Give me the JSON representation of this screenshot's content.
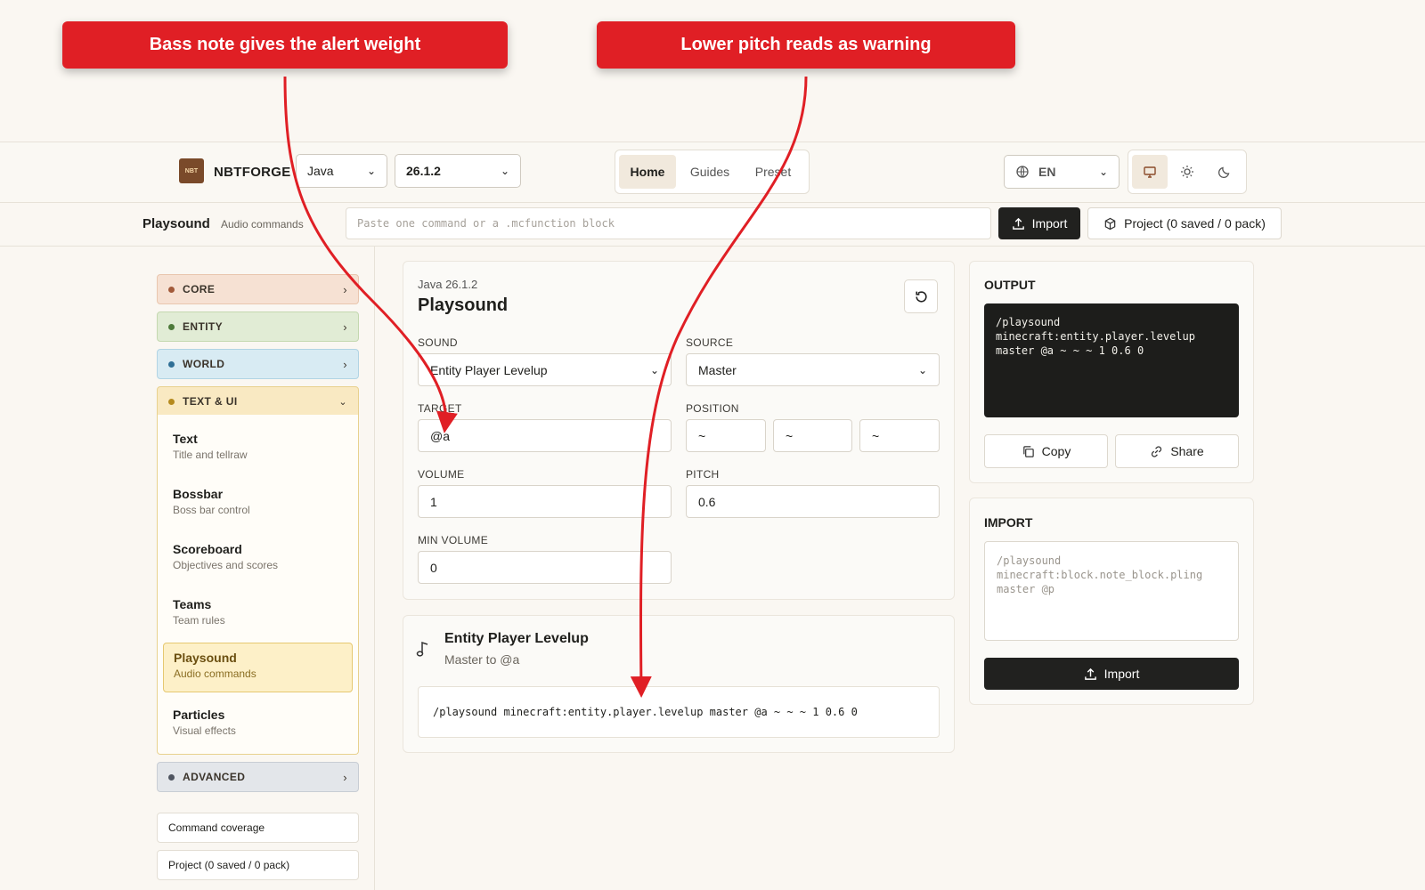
{
  "callouts": [
    {
      "text": "Bass note gives the alert weight"
    },
    {
      "text": "Lower pitch reads as warning"
    }
  ],
  "header": {
    "brand": "NBTFORGE",
    "logo_text": "NBT",
    "edition": "Java",
    "version": "26.1.2",
    "nav": [
      "Home",
      "Guides",
      "Preset"
    ],
    "language": "EN",
    "theme_icons": [
      "monitor-icon",
      "sun-icon",
      "moon-icon"
    ]
  },
  "toolbar": {
    "title": "Playsound",
    "subtitle": "Audio commands",
    "paste_placeholder": "Paste one command or a .mcfunction block",
    "import_label": "Import",
    "project_label": "Project (0 saved / 0 pack)"
  },
  "sidebar": {
    "categories": [
      {
        "label": "CORE",
        "color": "#a25a3a",
        "bg": "#f6e1d3",
        "border": "#e9c6ae"
      },
      {
        "label": "ENTITY",
        "color": "#4d7a3a",
        "bg": "#e1ecd5",
        "border": "#c4d8b0"
      },
      {
        "label": "WORLD",
        "color": "#2f6f96",
        "bg": "#d8ebf3",
        "border": "#b1d4e4"
      },
      {
        "label": "TEXT & UI",
        "color": "#b58a1e",
        "bg": "#f9e9c2",
        "border": "#e8d18e"
      },
      {
        "label": "ADVANCED",
        "color": "#4f5560",
        "bg": "#e3e6ea",
        "border": "#c8cdd4"
      }
    ],
    "items": [
      {
        "title": "Text",
        "desc": "Title and tellraw"
      },
      {
        "title": "Bossbar",
        "desc": "Boss bar control"
      },
      {
        "title": "Scoreboard",
        "desc": "Objectives and scores"
      },
      {
        "title": "Teams",
        "desc": "Team rules"
      },
      {
        "title": "Playsound",
        "desc": "Audio commands"
      },
      {
        "title": "Particles",
        "desc": "Visual effects"
      }
    ],
    "links": [
      "Command coverage",
      "Project (0 saved / 0 pack)"
    ]
  },
  "form": {
    "edition_line": "Java 26.1.2",
    "title": "Playsound",
    "sound_label": "SOUND",
    "sound_value": "Entity Player Levelup",
    "source_label": "SOURCE",
    "source_value": "Master",
    "target_label": "TARGET",
    "target_value": "@a",
    "position_label": "POSITION",
    "pos_x": "~",
    "pos_y": "~",
    "pos_z": "~",
    "volume_label": "VOLUME",
    "volume_value": "1",
    "pitch_label": "PITCH",
    "pitch_value": "0.6",
    "minvol_label": "MIN VOLUME",
    "minvol_value": "0"
  },
  "summary": {
    "title": "Entity Player Levelup",
    "subtitle": "Master to @a",
    "command": "/playsound minecraft:entity.player.levelup master @a ~ ~ ~ 1 0.6 0"
  },
  "output": {
    "heading": "OUTPUT",
    "code": "/playsound\nminecraft:entity.player.levelup\nmaster @a ~ ~ ~ 1 0.6 0",
    "copy_label": "Copy",
    "share_label": "Share"
  },
  "import_panel": {
    "heading": "IMPORT",
    "placeholder": "/playsound\nminecraft:block.note_block.pling\nmaster @p",
    "button_label": "Import"
  },
  "colors": {
    "accent_red": "#e01f25",
    "dark": "#21211f",
    "background": "#faf7f2"
  }
}
